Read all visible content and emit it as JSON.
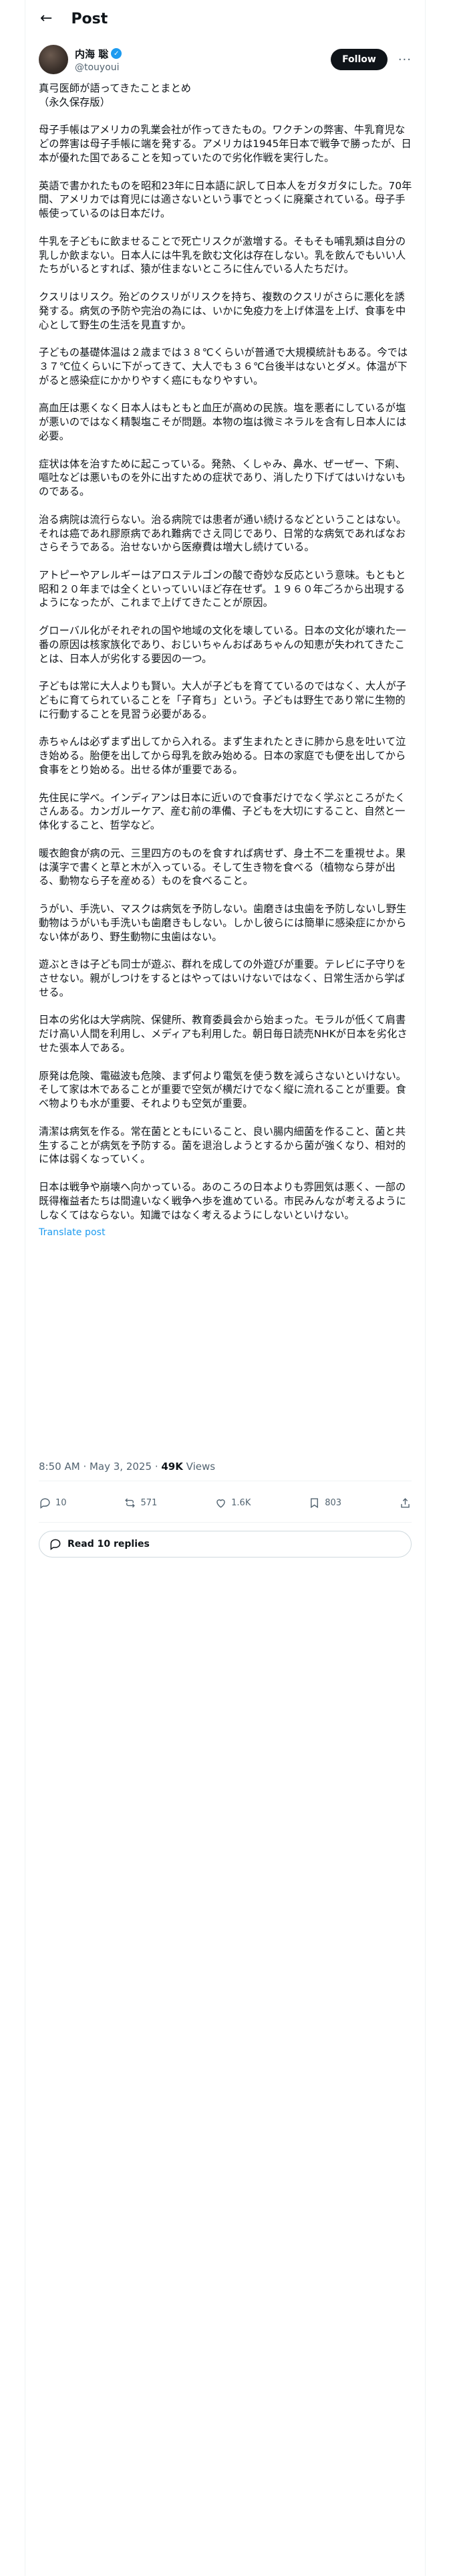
{
  "header": {
    "title": "Post"
  },
  "author": {
    "display_name": "内海 聡",
    "handle": "@touyoui",
    "follow_label": "Follow",
    "more_label": "···"
  },
  "post": {
    "paragraphs": [
      "真弓医師が語ってきたことまとめ\n（永久保存版）",
      "母子手帳はアメリカの乳業会社が作ってきたもの。ワクチンの弊害、牛乳育児などの弊害は母子手帳に端を発する。アメリカは1945年日本で戦争で勝ったが、日本が優れた国であることを知っていたので劣化作戦を実行した。",
      "英語で書かれたものを昭和23年に日本語に訳して日本人をガタガタにした。70年間、アメリカでは育児には適さないという事でとっくに廃棄されている。母子手帳使っているのは日本だけ。",
      "牛乳を子どもに飲ませることで死亡リスクが激増する。そもそも哺乳類は自分の乳しか飲まない。日本人には牛乳を飲む文化は存在しない。乳を飲んでもいい人たちがいるとすれば、猿が住まないところに住んでいる人たちだけ。",
      "クスリはリスク。殆どのクスリがリスクを持ち、複数のクスリがさらに悪化を誘発する。病気の予防や完治の為には、いかに免疫力を上げ体温を上げ、食事を中心として野生の生活を見直すか。",
      "子どもの基礎体温は２歳までは３８℃くらいが普通で大規模統計もある。今では３７℃位くらいに下がってきて、大人でも３６℃台後半はないとダメ。体温が下がると感染症にかかりやすく癌にもなりやすい。",
      "高血圧は悪くなく日本人はもともと血圧が高めの民族。塩を悪者にしているが塩が悪いのではなく精製塩こそが問題。本物の塩は微ミネラルを含有し日本人には必要。",
      "症状は体を治すために起こっている。発熱、くしゃみ、鼻水、ぜーぜー、下痢、嘔吐などは悪いものを外に出すための症状であり、消したり下げてはいけないものである。",
      "治る病院は流行らない。治る病院では患者が通い続けるなどということはない。それは癌であれ膠原病であれ難病でさえ同じであり、日常的な病気であればなおさらそうである。治せないから医療費は増大し続けている。",
      "アトピーやアレルギーはアロステルゴンの酸で奇妙な反応という意味。もともと昭和２０年までは全くといっていいほど存在せず。１９６０年ごろから出現するようになったが、これまで上げてきたことが原因。",
      "グローバル化がそれぞれの国や地域の文化を壊している。日本の文化が壊れた一番の原因は核家族化であり、おじいちゃんおばあちゃんの知恵が失われてきたことは、日本人が劣化する要因の一つ。",
      "子どもは常に大人よりも賢い。大人が子どもを育てているのではなく、大人が子どもに育てられていることを「子育ち」という。子どもは野生であり常に生物的に行動することを見習う必要がある。",
      "赤ちゃんは必ずまず出してから入れる。まず生まれたときに肺から息を吐いて泣き始める。胎便を出してから母乳を飲み始める。日本の家庭でも便を出してから食事をとり始める。出せる体が重要である。",
      "先住民に学べ。インディアンは日本に近いので食事だけでなく学ぶところがたくさんある。カンガルーケア、産む前の準備、子どもを大切にすること、自然と一体化すること、哲学など。",
      "暖衣飽食が病の元、三里四方のものを食すれば病せず、身土不二を重視せよ。果は漢字で書くと草と木が入っている。そして生き物を食べる（植物なら芽が出る、動物なら子を産める）ものを食べること。",
      "うがい、手洗い、マスクは病気を予防しない。歯磨きは虫歯を予防しないし野生動物はうがいも手洗いも歯磨きもしない。しかし彼らには簡単に感染症にかからない体があり、野生動物に虫歯はない。",
      "遊ぶときは子ども同士が遊ぶ、群れを成しての外遊びが重要。テレビに子守りをさせない。親がしつけをするとはやってはいけないではなく、日常生活から学ばせる。",
      "日本の劣化は大学病院、保健所、教育委員会から始まった。モラルが低くて肩書だけ高い人間を利用し、メディアも利用した。朝日毎日読売NHKが日本を劣化させた張本人である。",
      "原発は危険、電磁波も危険、まず何より電気を使う数を減らさないといけない。そして家は木であることが重要で空気が横だけでなく縦に流れることが重要。食べ物よりも水が重要、それよりも空気が重要。",
      "清潔は病気を作る。常在菌とともにいること、良い腸内細菌を作ること、菌と共生することが病気を予防する。菌を退治しようとするから菌が強くなり、相対的に体は弱くなっていく。",
      "日本は戦争や崩壊へ向かっている。あのころの日本よりも雰囲気は悪く、一部の既得権益者たちは間違いなく戦争へ歩を進めている。市民みんなが考えるようにしなくてはならない。知識ではなく考えるようにしないといけない。"
    ],
    "translate_label": "Translate post",
    "time": "8:50 AM",
    "date": "May 3, 2025",
    "views_count": "49K",
    "views_label": "Views"
  },
  "stats": {
    "replies": "10",
    "reposts": "571",
    "likes": "1.6K",
    "bookmarks": "803"
  },
  "read_replies": {
    "label": "Read 10 replies"
  },
  "colors": {
    "accent": "#1d9bf0",
    "text": "#0f1419",
    "muted": "#536471",
    "border": "#eff3f4"
  }
}
